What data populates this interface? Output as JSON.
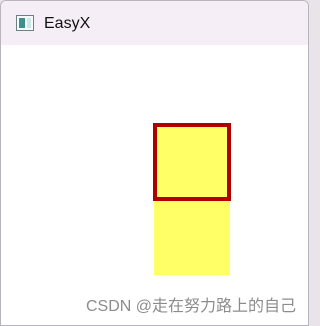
{
  "window": {
    "title": "EasyX",
    "icon": "easyx-app-icon"
  },
  "canvas": {
    "background": "#ffffff",
    "shapes": [
      {
        "name": "outlined-yellow-square",
        "fill": "#ffff66",
        "stroke": "#b00000"
      },
      {
        "name": "plain-yellow-square",
        "fill": "#ffff66",
        "stroke": "none"
      }
    ]
  },
  "watermark": {
    "text": "CSDN @走在努力路上的自己"
  }
}
